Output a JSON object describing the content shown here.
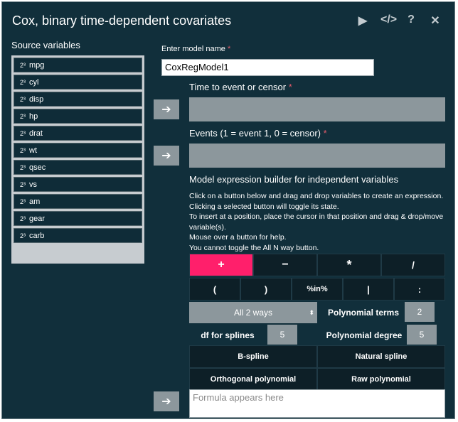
{
  "dialog": {
    "title": "Cox, binary time-dependent covariates",
    "icons": [
      "play-icon",
      "code-icon",
      "help-icon",
      "close-icon"
    ]
  },
  "source": {
    "title": "Source variables",
    "scale_icon": "2³",
    "items": [
      "mpg",
      "cyl",
      "disp",
      "hp",
      "drat",
      "wt",
      "qsec",
      "vs",
      "am",
      "gear",
      "carb"
    ]
  },
  "model_name": {
    "label": "Enter model name",
    "required": "*",
    "value": "CoxRegModel1"
  },
  "time": {
    "label": "Time to event or censor",
    "required": "*"
  },
  "events": {
    "label": "Events (1 = event 1, 0 = censor)",
    "required": "*"
  },
  "builder": {
    "title": "Model expression builder for independent variables",
    "help_lines": [
      "Click on a button below and drag and drop variables to create an expression.",
      "Clicking a selected button will toggle its state.",
      "To insert at a position, place the cursor in that position and drag & drop/move variable(s).",
      "Mouse over a button for help.",
      "You cannot toggle the All N way button."
    ],
    "ops_row1": [
      "+",
      "−",
      "*",
      "/"
    ],
    "ops_row2": [
      "(",
      ")",
      "%in%",
      "|",
      ":"
    ],
    "all_ways": "All 2 ways",
    "poly_terms_label": "Polynomial terms",
    "poly_terms_value": "2",
    "df_splines_label": "df for splines",
    "df_splines_value": "5",
    "poly_degree_label": "Polynomial degree",
    "poly_degree_value": "5",
    "bspline": "B-spline",
    "natural_spline": "Natural spline",
    "orthogonal_polynomial": "Orthogonal polynomial",
    "raw_polynomial": "Raw polynomial",
    "formula_placeholder": "Formula appears here"
  },
  "colors": {
    "background": "#112f3b",
    "active_op": "#ff1f6b",
    "panel": "#8c979c"
  }
}
